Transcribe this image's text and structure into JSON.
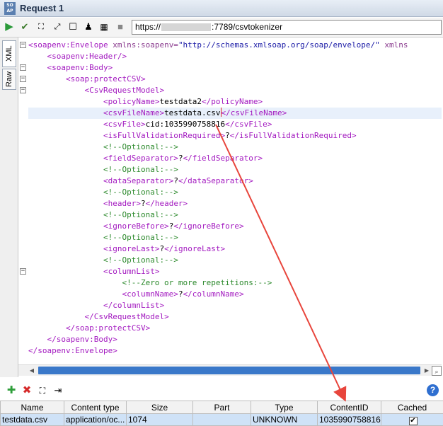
{
  "window": {
    "badge": "SOAP",
    "title": "Request 1"
  },
  "toolbar": {
    "url_prefix": "https://",
    "url_suffix": ":7789/csvtokenizer"
  },
  "sidetabs": {
    "xml": "XML",
    "raw": "Raw"
  },
  "editor": {
    "lines": [
      {
        "i": 0,
        "fold": "-",
        "parts": [
          [
            "tag",
            "<soapenv:Envelope "
          ],
          [
            "attr",
            "xmlns:soapenv="
          ],
          [
            "str",
            "\"http://schemas.xmlsoap.org/soap/envelope/\""
          ],
          [
            "attr",
            " xmlns"
          ]
        ]
      },
      {
        "i": 1,
        "fold": "",
        "parts": [
          [
            "tag",
            "<soapenv:Header/>"
          ]
        ]
      },
      {
        "i": 1,
        "fold": "-",
        "parts": [
          [
            "tag",
            "<soapenv:Body>"
          ]
        ]
      },
      {
        "i": 2,
        "fold": "-",
        "parts": [
          [
            "tag",
            "<soap:protectCSV>"
          ]
        ]
      },
      {
        "i": 3,
        "fold": "-",
        "parts": [
          [
            "tag",
            "<CsvRequestModel>"
          ]
        ]
      },
      {
        "i": 4,
        "fold": "",
        "parts": [
          [
            "tag",
            "<policyName>"
          ],
          [
            "txt",
            "testdata2"
          ],
          [
            "tag",
            "</policyName>"
          ]
        ]
      },
      {
        "i": 4,
        "fold": "",
        "hl": true,
        "parts": [
          [
            "tag",
            "<csvFileName>"
          ],
          [
            "txt",
            "testdata.csv"
          ],
          [
            "caret",
            ""
          ],
          [
            "tag",
            "</csvFileName>"
          ]
        ]
      },
      {
        "i": 4,
        "fold": "",
        "parts": [
          [
            "tag",
            "<csvFile>"
          ],
          [
            "txt",
            "cid:1035990758816"
          ],
          [
            "tag",
            "</csvFile>"
          ]
        ]
      },
      {
        "i": 4,
        "fold": "",
        "parts": [
          [
            "tag",
            "<isFullValidationRequired>"
          ],
          [
            "txt",
            "?"
          ],
          [
            "tag",
            "</isFullValidationRequired>"
          ]
        ]
      },
      {
        "i": 4,
        "fold": "",
        "parts": [
          [
            "cmt",
            "<!--Optional:-->"
          ]
        ]
      },
      {
        "i": 4,
        "fold": "",
        "parts": [
          [
            "tag",
            "<fieldSeparator>"
          ],
          [
            "txt",
            "?"
          ],
          [
            "tag",
            "</fieldSeparator>"
          ]
        ]
      },
      {
        "i": 4,
        "fold": "",
        "parts": [
          [
            "cmt",
            "<!--Optional:-->"
          ]
        ]
      },
      {
        "i": 4,
        "fold": "",
        "parts": [
          [
            "tag",
            "<dataSeparator>"
          ],
          [
            "txt",
            "?"
          ],
          [
            "tag",
            "</dataSeparator>"
          ]
        ]
      },
      {
        "i": 4,
        "fold": "",
        "parts": [
          [
            "cmt",
            "<!--Optional:-->"
          ]
        ]
      },
      {
        "i": 4,
        "fold": "",
        "parts": [
          [
            "tag",
            "<header>"
          ],
          [
            "txt",
            "?"
          ],
          [
            "tag",
            "</header>"
          ]
        ]
      },
      {
        "i": 4,
        "fold": "",
        "parts": [
          [
            "cmt",
            "<!--Optional:-->"
          ]
        ]
      },
      {
        "i": 4,
        "fold": "",
        "parts": [
          [
            "tag",
            "<ignoreBefore>"
          ],
          [
            "txt",
            "?"
          ],
          [
            "tag",
            "</ignoreBefore>"
          ]
        ]
      },
      {
        "i": 4,
        "fold": "",
        "parts": [
          [
            "cmt",
            "<!--Optional:-->"
          ]
        ]
      },
      {
        "i": 4,
        "fold": "",
        "parts": [
          [
            "tag",
            "<ignoreLast>"
          ],
          [
            "txt",
            "?"
          ],
          [
            "tag",
            "</ignoreLast>"
          ]
        ]
      },
      {
        "i": 4,
        "fold": "",
        "parts": [
          [
            "cmt",
            "<!--Optional:-->"
          ]
        ]
      },
      {
        "i": 4,
        "fold": "-",
        "parts": [
          [
            "tag",
            "<columnList>"
          ]
        ]
      },
      {
        "i": 5,
        "fold": "",
        "parts": [
          [
            "cmt",
            "<!--Zero or more repetitions:-->"
          ]
        ]
      },
      {
        "i": 5,
        "fold": "",
        "parts": [
          [
            "tag",
            "<columnName>"
          ],
          [
            "txt",
            "?"
          ],
          [
            "tag",
            "</columnName>"
          ]
        ]
      },
      {
        "i": 4,
        "fold": "",
        "parts": [
          [
            "tag",
            "</columnList>"
          ]
        ]
      },
      {
        "i": 3,
        "fold": "",
        "parts": [
          [
            "tag",
            "</CsvRequestModel>"
          ]
        ]
      },
      {
        "i": 2,
        "fold": "",
        "parts": [
          [
            "tag",
            "</soap:protectCSV>"
          ]
        ]
      },
      {
        "i": 1,
        "fold": "",
        "parts": [
          [
            "tag",
            "</soapenv:Body>"
          ]
        ]
      },
      {
        "i": 0,
        "fold": "",
        "parts": [
          [
            "tag",
            "</soapenv:Envelope>"
          ]
        ]
      }
    ]
  },
  "attachments": {
    "columns": [
      "Name",
      "Content type",
      "Size",
      "Part",
      "Type",
      "ContentID",
      "Cached"
    ],
    "rows": [
      {
        "name": "testdata.csv",
        "content_type": "application/oc...",
        "size": "1074",
        "part": "",
        "type": "UNKNOWN",
        "content_id": "1035990758816",
        "cached": true
      }
    ]
  },
  "colors": {
    "annotation_arrow": "#e8453c",
    "selection": "#cfe2f7"
  }
}
